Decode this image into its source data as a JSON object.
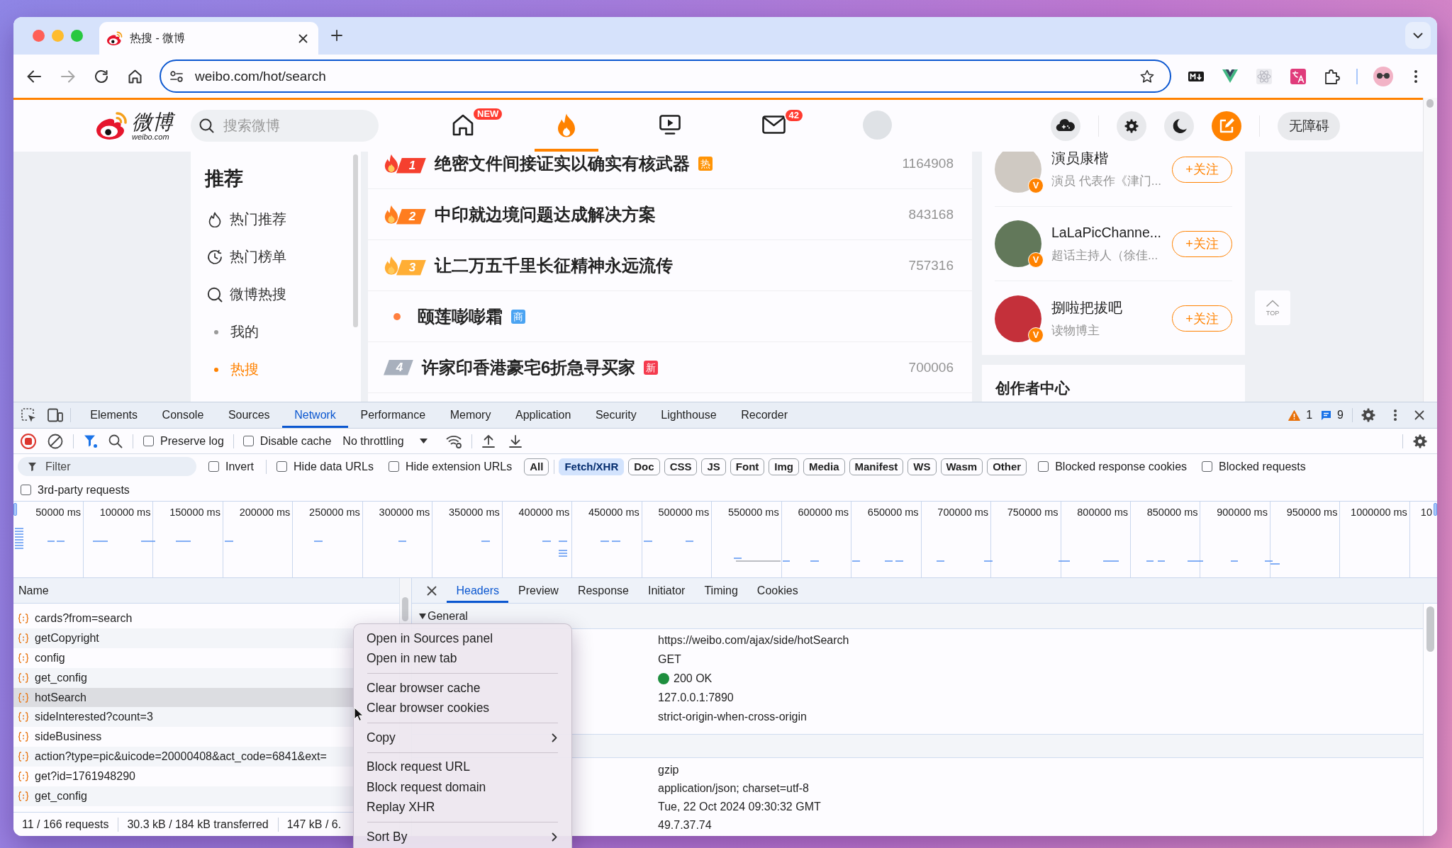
{
  "browser": {
    "tab_title": "热搜 - 微博",
    "url": "weibo.com/hot/search"
  },
  "weibo": {
    "logo": {
      "name": "微博",
      "domain": "weibo.com"
    },
    "search": {
      "placeholder": "搜索微博"
    },
    "nav": [
      {
        "kind": "icon",
        "badge": "NEW",
        "selected": false
      },
      {
        "kind": "icon",
        "selected": true
      },
      {
        "kind": "icon",
        "selected": false
      },
      {
        "kind": "icon",
        "badge": "42",
        "selected": false
      },
      {
        "kind": "picture",
        "selected": false
      }
    ],
    "accessibility_button": "无障碍",
    "sidebar": {
      "title": "推荐",
      "items": [
        {
          "kind": "icon",
          "label": "热门推荐",
          "selected": false
        },
        {
          "kind": "icon",
          "label": "热门榜单",
          "selected": false
        },
        {
          "kind": "icon",
          "label": "微博热搜",
          "selected": false
        },
        {
          "kind": "bullet",
          "label": "我的",
          "selected": false
        },
        {
          "kind": "bullet",
          "label": "热搜",
          "selected": true
        }
      ]
    },
    "hot_list": [
      {
        "kind": "ranked",
        "rank": "1",
        "flame": true,
        "color": "#f5402f",
        "title": "绝密文件间接证实以确实有核武器",
        "tag": {
          "text": "热",
          "color": "#ff9406"
        },
        "count": "1164908"
      },
      {
        "kind": "ranked",
        "rank": "2",
        "flame": true,
        "color": "#ff7d1f",
        "title": "中印就边境问题达成解决方案",
        "count": "843168"
      },
      {
        "kind": "ranked",
        "rank": "3",
        "flame": true,
        "color": "#ffae35",
        "title": "让二万五千里长征精神永远流传",
        "count": "757316"
      },
      {
        "kind": "promoted",
        "color": "#ff7f3f",
        "title": "颐莲嘭嘭霜",
        "tag": {
          "text": "商",
          "color": "#4aa3f2"
        }
      },
      {
        "kind": "ranked",
        "rank": "4",
        "flame": false,
        "color": "#a8b0bd",
        "title": "许家印香港豪宅6折急寻买家",
        "tag": {
          "text": "新",
          "color": "#f53a4e"
        },
        "count": "700006"
      }
    ],
    "suggested_users": [
      {
        "name": "演员康楷",
        "description": "演员 代表作《津门...",
        "badge": "V",
        "follow": "+关注"
      },
      {
        "name": "LaLaPicChanne...",
        "description": "超话主持人（徐佳...",
        "badge": "V",
        "follow": "+关注"
      },
      {
        "name": "捌啦把拔吧",
        "description": "读物博主",
        "badge": "V",
        "follow": "+关注"
      }
    ],
    "creator_center": {
      "title": "创作者中心"
    },
    "top_button": "TOP"
  },
  "devtools": {
    "tabs": [
      {
        "label": "Elements",
        "selected": false
      },
      {
        "label": "Console",
        "selected": false
      },
      {
        "label": "Sources",
        "selected": false
      },
      {
        "label": "Network",
        "selected": true
      },
      {
        "label": "Performance",
        "selected": false
      },
      {
        "label": "Memory",
        "selected": false
      },
      {
        "label": "Application",
        "selected": false
      },
      {
        "label": "Security",
        "selected": false
      },
      {
        "label": "Lighthouse",
        "selected": false
      },
      {
        "label": "Recorder",
        "selected": false
      }
    ],
    "issues": {
      "warnings": "1",
      "messages": "9"
    },
    "toolbar": {
      "recording": true,
      "preserve_log": {
        "label": "Preserve log",
        "checked": false
      },
      "disable_cache": {
        "label": "Disable cache",
        "checked": false
      },
      "throttling": "No throttling"
    },
    "filter": {
      "placeholder": "Filter",
      "options": [
        {
          "label": "Invert",
          "checked": false
        },
        {
          "label": "Hide data URLs",
          "checked": false
        },
        {
          "label": "Hide extension URLs",
          "checked": false
        }
      ],
      "types": [
        {
          "label": "All",
          "selected": false
        },
        {
          "label": "Fetch/XHR",
          "selected": true
        },
        {
          "label": "Doc",
          "selected": false
        },
        {
          "label": "CSS",
          "selected": false
        },
        {
          "label": "JS",
          "selected": false
        },
        {
          "label": "Font",
          "selected": false
        },
        {
          "label": "Img",
          "selected": false
        },
        {
          "label": "Media",
          "selected": false
        },
        {
          "label": "Manifest",
          "selected": false
        },
        {
          "label": "WS",
          "selected": false
        },
        {
          "label": "Wasm",
          "selected": false
        },
        {
          "label": "Other",
          "selected": false
        }
      ],
      "blocked": [
        {
          "label": "Blocked response cookies",
          "checked": false
        },
        {
          "label": "Blocked requests",
          "checked": false
        }
      ],
      "third_party": {
        "label": "3rd-party requests",
        "checked": false
      }
    },
    "overview": {
      "ticks": [
        "50000 ms",
        "100000 ms",
        "150000 ms",
        "200000 ms",
        "250000 ms",
        "300000 ms",
        "350000 ms",
        "400000 ms",
        "450000 ms",
        "500000 ms",
        "550000 ms",
        "600000 ms",
        "650000 ms",
        "700000 ms",
        "750000 ms",
        "800000 ms",
        "850000 ms",
        "900000 ms",
        "950000 ms",
        "1000000 ms",
        "10"
      ]
    },
    "requests": {
      "column": "Name",
      "rows": [
        {
          "name": "cards?from=search",
          "selected": false
        },
        {
          "name": "getCopyright",
          "selected": false
        },
        {
          "name": "config",
          "selected": false
        },
        {
          "name": "get_config",
          "selected": false
        },
        {
          "name": "hotSearch",
          "selected": true
        },
        {
          "name": "sideInterested?count=3",
          "selected": false
        },
        {
          "name": "sideBusiness",
          "selected": false
        },
        {
          "name": "action?type=pic&uicode=20000408&act_code=6841&ext=",
          "selected": false
        },
        {
          "name": "get?id=1761948290",
          "selected": false
        },
        {
          "name": "get_config",
          "selected": false
        }
      ]
    },
    "status": [
      "11 / 166 requests",
      "30.3 kB / 184 kB transferred",
      "147 kB / 6."
    ],
    "details": {
      "tabs": [
        {
          "label": "Headers",
          "selected": true
        },
        {
          "label": "Preview",
          "selected": false
        },
        {
          "label": "Response",
          "selected": false
        },
        {
          "label": "Initiator",
          "selected": false
        },
        {
          "label": "Timing",
          "selected": false
        },
        {
          "label": "Cookies",
          "selected": false
        }
      ],
      "sections": [
        {
          "title": "General",
          "expanded": true,
          "rows": [
            {
              "value": "https://weibo.com/ajax/side/hotSearch"
            },
            {
              "value": "GET"
            },
            {
              "value": "200 OK",
              "color": "#1e8e3e"
            },
            {
              "value": "127.0.0.1:7890"
            },
            {
              "value": "strict-origin-when-cross-origin"
            }
          ]
        },
        {
          "rows": [
            {
              "value": "gzip"
            },
            {
              "value": "application/json; charset=utf-8"
            },
            {
              "value": "Tue, 22 Oct 2024 09:30:32 GMT"
            },
            {
              "value": "49.7.37.74"
            }
          ]
        }
      ]
    }
  },
  "context_menu": {
    "items": [
      {
        "kind": "item",
        "label": "Open in Sources panel"
      },
      {
        "kind": "item",
        "label": "Open in new tab"
      },
      {
        "kind": "separator"
      },
      {
        "kind": "item",
        "label": "Clear browser cache"
      },
      {
        "kind": "item",
        "label": "Clear browser cookies"
      },
      {
        "kind": "separator"
      },
      {
        "kind": "submenu",
        "label": "Copy"
      },
      {
        "kind": "separator"
      },
      {
        "kind": "item",
        "label": "Block request URL"
      },
      {
        "kind": "item",
        "label": "Block request domain"
      },
      {
        "kind": "item",
        "label": "Replay XHR"
      },
      {
        "kind": "separator"
      },
      {
        "kind": "submenu",
        "label": "Sort By"
      }
    ]
  }
}
